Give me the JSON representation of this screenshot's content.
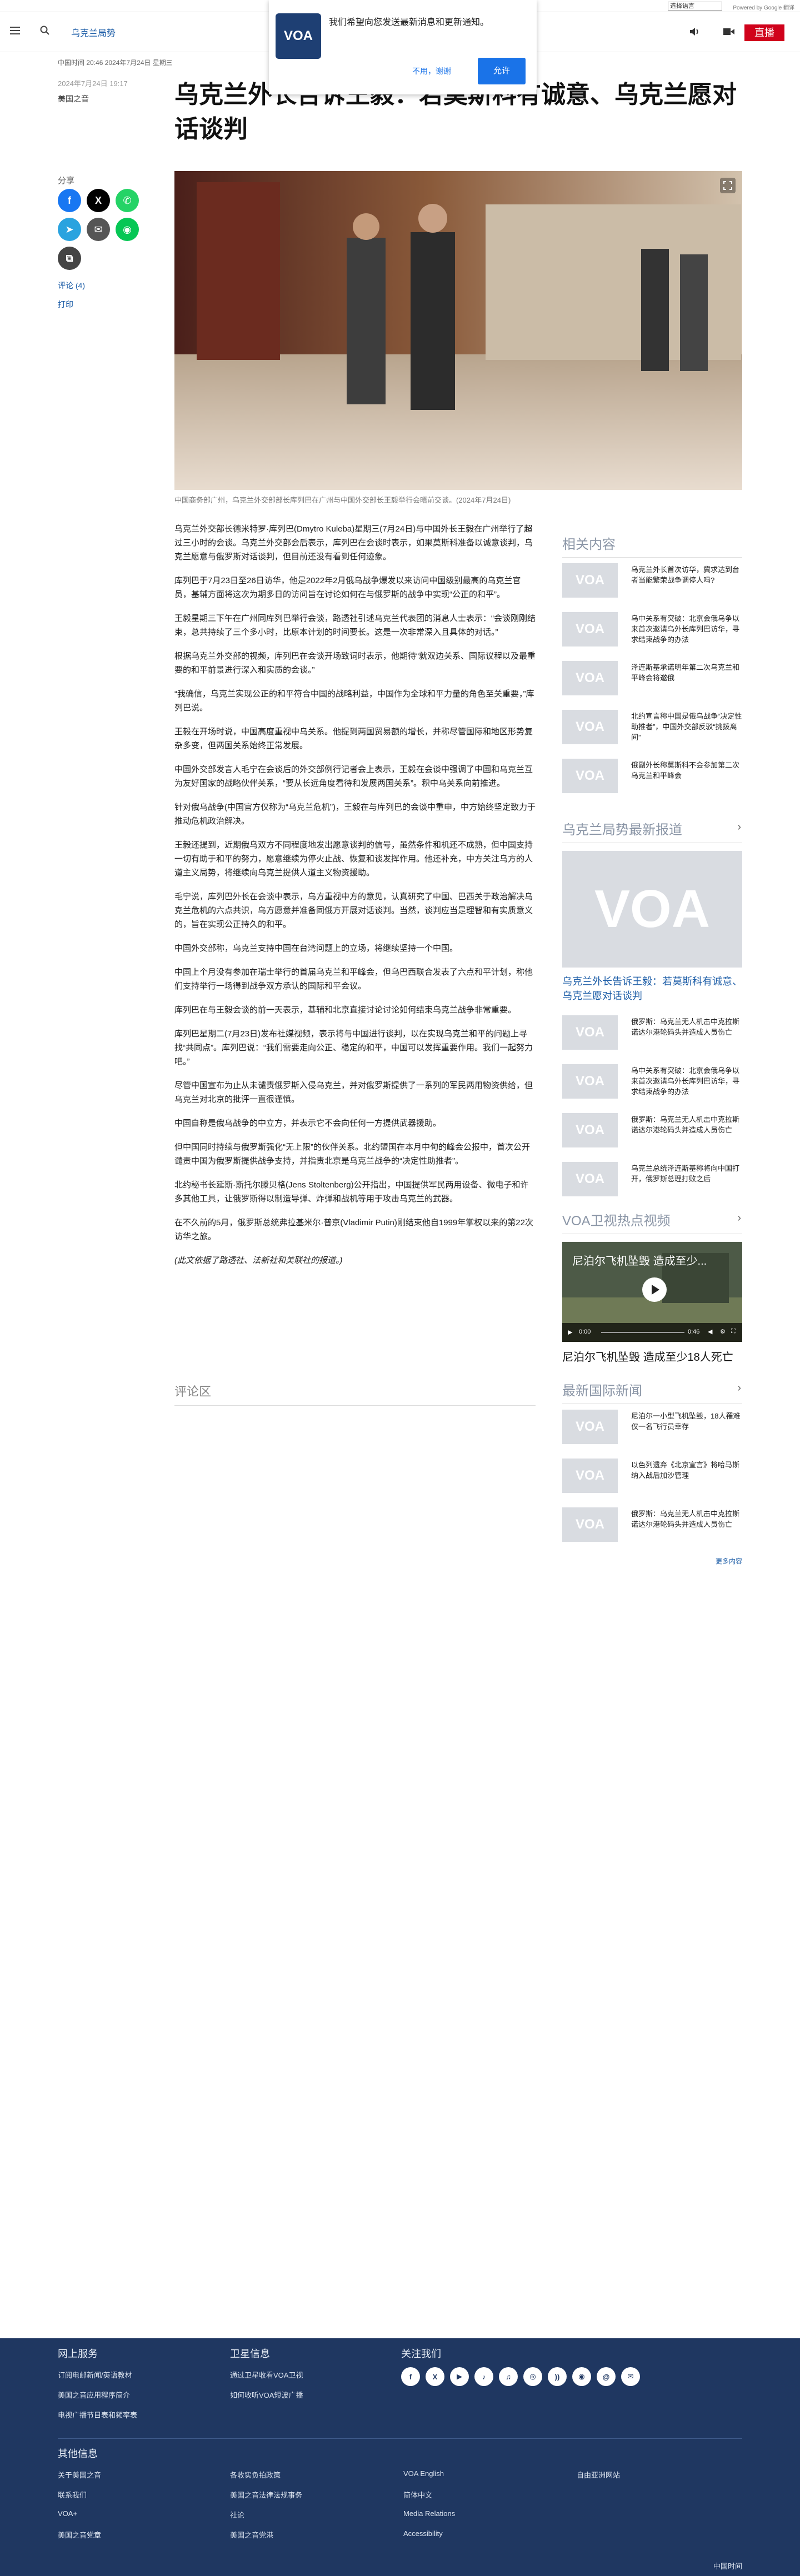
{
  "topstrip": {
    "language_select": "选择语言",
    "powered_by": "Powered by Google 翻译"
  },
  "header": {
    "section_link": "乌克兰局势",
    "logo_text": "VOA",
    "live_label": "直播"
  },
  "notify": {
    "message": "我们希望向您发送最新消息和更新通知。",
    "decline": "不用，谢谢",
    "accept": "允许"
  },
  "meta": {
    "date_line": "中国时间 20:46 2024年7月24日 星期三",
    "date_line2": "2024年7月24日 19:17",
    "byline": "美国之音"
  },
  "headline": "乌克兰外长告诉王毅：若莫斯科有诚意、乌克兰愿对话谈判",
  "share": {
    "label": "分享",
    "comment": "评论 (4)",
    "print": "打印"
  },
  "hero": {
    "caption": "中国商务部广州，乌克兰外交部部长库列巴在广州与中国外交部长王毅举行会晤前交谈。(2024年7月24日)"
  },
  "article": {
    "paragraphs": [
      "乌克兰外交部长德米特罗·库列巴(Dmytro Kuleba)星期三(7月24日)与中国外长王毅在广州举行了超过三小时的会谈。乌克兰外交部会后表示，库列巴在会谈时表示，如果莫斯科准备以诚意谈判，乌克兰愿意与俄罗斯对话谈判，但目前还没有看到任何迹象。",
      "库列巴于7月23日至26日访华，他是2022年2月俄乌战争爆发以来访问中国级别最高的乌克兰官员，基辅方面将这次为期多日的访问旨在讨论如何在与俄罗斯的战争中实现“公正的和平”。",
      "王毅星期三下午在广州同库列巴举行会谈，路透社引述乌克兰代表团的消息人士表示：“会谈刚刚结束，总共持续了三个多小时，比原本计划的时间要长。这是一次非常深入且具体的对话。”",
      "根据乌克兰外交部的视频，库列巴在会谈开场致词时表示，他期待“就双边关系、国际议程以及最重要的和平前景进行深入和实质的会谈。”",
      "“我确信，乌克兰实现公正的和平符合中国的战略利益，中国作为全球和平力量的角色至关重要，”库列巴说。",
      "王毅在开场时说，中国高度重视中乌关系。他提到两国贸易额的增长，并称尽管国际和地区形势复杂多变，但两国关系始终正常发展。",
      "中国外交部发言人毛宁在会谈后的外交部例行记者会上表示，王毅在会谈中强调了中国和乌克兰互为友好国家的战略伙伴关系，“要从长远角度看待和发展两国关系”。积中乌关系向前推进。",
      "针对俄乌战争(中国官方仅称为“乌克兰危机”)，王毅在与库列巴的会谈中重申，中方始终坚定致力于推动危机政治解决。",
      "王毅还提到，近期俄乌双方不同程度地发出愿意谈判的信号，虽然条件和机还不成熟，但中国支持一切有助于和平的努力，愿意继续为停火止战、恢复和谈发挥作用。他还补充，中方关注乌方的人道主义局势，将继续向乌克兰提供人道主义物资援助。",
      "毛宁说，库列巴外长在会谈中表示，乌方重视中方的意见，认真研究了中国、巴西关于政治解决乌克兰危机的六点共识，乌方愿意并准备同俄方开展对话谈判。当然，谈判应当是理智和有实质意义的，旨在实现公正持久的和平。",
      "中国外交部称，乌克兰支持中国在台湾问题上的立场，将继续坚持一个中国。",
      "中国上个月没有参加在瑞士举行的首届乌克兰和平峰会，但乌巴西联合发表了六点和平计划，称他们支持举行一场得到战争双方承认的国际和平会议。",
      "库列巴在与王毅会谈的前一天表示，基辅和北京直接讨论讨论如何结束乌克兰战争非常重要。",
      "库列巴星期二(7月23日)发布社媒视频，表示将与中国进行谈判，以在实现乌克兰和平的问题上寻找“共同点”。库列巴说：“我们需要走向公正、稳定的和平，中国可以发挥重要作用。我们一起努力吧。”",
      "尽管中国宣布为止从未谴责俄罗斯入侵乌克兰，并对俄罗斯提供了一系列的军民两用物资供给，但乌克兰对北京的批评一直很谨慎。",
      "中国自称是俄乌战争的中立方，并表示它不会向任何一方提供武器援助。",
      "但中国同时持续与俄罗斯强化“无上限”的伙伴关系。北约盟国在本月中旬的峰会公报中，首次公开谴责中国为俄罗斯提供战争支持，并指责北京是乌克兰战争的“决定性助推者”。",
      "北约秘书长延斯·斯托尔滕贝格(Jens Stoltenberg)公开指出，中国提供军民两用设备、微电子和许多其他工具，让俄罗斯得以制造导弹、炸弹和战机等用于攻击乌克兰的武器。",
      "在不久前的5月，俄罗斯总统弗拉基米尔·普京(Vladimir Putin)刚结束他自1999年掌权以来的第22次访华之旅。"
    ],
    "note": "(此文依据了路透社、法新社和美联社的报道。)",
    "comments_title": "评论区"
  },
  "sidebar": {
    "related_title": "相关内容",
    "related": [
      "乌克兰外长首次访华，冀求达到台者当能繁荣战争调停人吗?",
      "乌中关系有突破：北京会俄乌争以来首次邀请乌外长库列巴访华，寻求结束战争的办法",
      "泽连斯基承诺明年第二次乌克兰和平峰会将邀俄",
      "北约宣言称中国是俄乌战争“决定性助推者”，中国外交部反驳“挑拨离间”",
      "俄副外长称莫斯科不会参加第二次乌克兰和平峰会"
    ],
    "latest_title": "乌克兰局势最新报道",
    "latest_big": "乌克兰外长告诉王毅：若莫斯科有诚意、乌克兰愿对话谈判",
    "latest": [
      "俄罗斯：乌克兰无人机击中克拉斯诺达尔港轮码头并造成人员伤亡",
      "乌中关系有突破：北京会俄乌争以来首次邀请乌外长库列巴访华，寻求结束战争的办法",
      "俄罗斯：乌克兰无人机击中克拉斯诺达尔港轮码头并造成人员伤亡",
      "乌克兰总统泽连斯基称将向中国打开，俄罗斯总理打败之后"
    ],
    "video_title": "VOA卫视热点视频",
    "video_overlay": "尼泊尔飞机坠毁 造成至少...",
    "video_time": "0:00",
    "video_duration": "0:46",
    "video_caption": "尼泊尔飞机坠毁 造成至少18人死亡",
    "intl_title": "最新国际新闻",
    "intl": [
      "尼泊尔一小型飞机坠毁，18人罹难仅一名飞行员幸存",
      "以色列遗弃《北京宣言》将哈马斯纳入战后加沙管理",
      "俄罗斯：乌克兰无人机击中克拉斯诺达尔港轮码头并造成人员伤亡"
    ],
    "more": "更多内容"
  },
  "footer": {
    "col1_title": "网上服务",
    "col1": [
      "订阅电邮新闻/英语教材",
      "美国之音应用程序简介",
      "电视广播节目表和频率表"
    ],
    "col2_title": "卫星信息",
    "col2": [
      "通过卫星收看VOA卫视",
      "如何收听VOA短波广播"
    ],
    "col3_title": "关注我们",
    "social": [
      "f",
      "X",
      "▶",
      "♪",
      "♫",
      "◎",
      "))",
      "◉",
      "@",
      "✉"
    ],
    "col4_title": "其他信息",
    "links": [
      "关于美国之音",
      "各收实负拍政策",
      "VOA English",
      "自由亚洲网站",
      "联系我们",
      "美国之音法律法规事务",
      "简体中文",
      "",
      "VOA+",
      "社论",
      "Media Relations",
      "",
      "美国之音党章",
      "美国之音党港",
      "Accessibility",
      ""
    ],
    "copyright": "中国时间"
  }
}
